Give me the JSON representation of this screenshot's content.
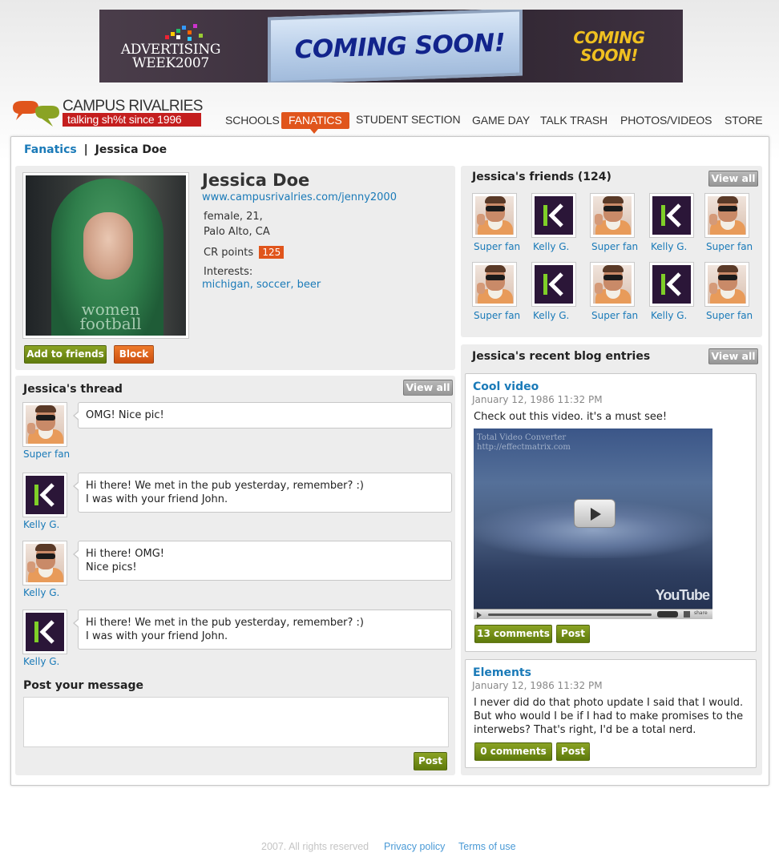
{
  "banner": {
    "brand_line1": "ADVERTISING",
    "brand_line2": "WEEK2007",
    "headline": "COMING SOON!",
    "side_line1": "COMING",
    "side_line2": "SOON!"
  },
  "site": {
    "brand": "CAMPUS RIVALRIES",
    "tagline": "talking sh%t since 1996"
  },
  "nav": [
    {
      "label": "SCHOOLS",
      "active": false
    },
    {
      "label": "FANATICS",
      "active": true
    },
    {
      "label": "STUDENT SECTION",
      "active": false
    },
    {
      "label": "GAME DAY",
      "active": false
    },
    {
      "label": "TALK TRASH",
      "active": false
    },
    {
      "label": "PHOTOS/VIDEOS",
      "active": false
    },
    {
      "label": "STORE",
      "active": false
    }
  ],
  "breadcrumb": {
    "parent": "Fanatics",
    "separator": "|",
    "current": "Jessica Doe"
  },
  "profile": {
    "name": "Jessica Doe",
    "url": "www.campusrivalries.com/jenny2000",
    "gender_age": "female, 21,",
    "location": "Palo Alto, CA",
    "points_label": "CR points",
    "points": "125",
    "interests_label": "Interests:",
    "interests": [
      "michigan",
      "soccer",
      "beer"
    ],
    "interest_sep1": ",",
    "interest_sep2": ",",
    "photo_shirt_text": "women football",
    "add_label": "Add to friends",
    "block_label": "Block"
  },
  "friends": {
    "title": "Jessica's friends (124)",
    "view_all": "View all",
    "items": [
      {
        "name": "Super fan",
        "avatar": "superfan"
      },
      {
        "name": "Kelly G.",
        "avatar": "kelly"
      },
      {
        "name": "Super fan",
        "avatar": "superfan"
      },
      {
        "name": "Kelly G.",
        "avatar": "kelly"
      },
      {
        "name": "Super fan",
        "avatar": "superfan"
      },
      {
        "name": "Super fan",
        "avatar": "superfan"
      },
      {
        "name": "Kelly G.",
        "avatar": "kelly"
      },
      {
        "name": "Super fan",
        "avatar": "superfan"
      },
      {
        "name": "Kelly G.",
        "avatar": "kelly"
      },
      {
        "name": "Super fan",
        "avatar": "superfan"
      }
    ]
  },
  "thread": {
    "title": "Jessica's thread",
    "view_all": "View all",
    "messages": [
      {
        "author": "Super fan",
        "avatar": "superfan",
        "line1": "OMG! Nice pic!",
        "line2": ""
      },
      {
        "author": "Kelly G.",
        "avatar": "kelly",
        "line1": "Hi there! We met in the pub yesterday, remember? :)",
        "line2": "I was with your friend John."
      },
      {
        "author": "Kelly G.",
        "avatar": "superfan",
        "line1": "Hi there! OMG!",
        "line2": "Nice pics!"
      },
      {
        "author": "Kelly G.",
        "avatar": "kelly",
        "line1": "Hi there! We met in the pub yesterday, remember? :)",
        "line2": "I was with your friend John."
      }
    ],
    "post_title": "Post your message",
    "post_placeholder": "",
    "post_label": "Post"
  },
  "blog": {
    "title": "Jessica's recent blog entries",
    "view_all": "View all",
    "entries": [
      {
        "title": "Cool video",
        "date": "January 12, 1986 11:32 PM",
        "text": "Check out this video. it's a must see!",
        "video_caption_line1": "Total Video Converter",
        "video_caption_line2": "http://effectmatrix.com",
        "video_brand": "YouTube",
        "video_share": "share",
        "comments_label": "13 comments",
        "post_label": "Post"
      },
      {
        "title": "Elements",
        "date": "January 12, 1986 11:32 PM",
        "text_line1": "I never did do that photo update I said that I would.",
        "text_line2": "But who would I be if I had to make promises to the",
        "text_line3": "interwebs? That's right, I'd be a total nerd.",
        "comments_label": "0 comments",
        "post_label": "Post"
      }
    ]
  },
  "footer": {
    "copyright": "2007. All rights reserved",
    "privacy": "Privacy policy",
    "terms": "Terms of use"
  },
  "colors": {
    "accent_orange": "#e0551c",
    "link_blue": "#1a7ab8",
    "button_green": "#6f8c14",
    "logo_red": "#c41e1e"
  }
}
